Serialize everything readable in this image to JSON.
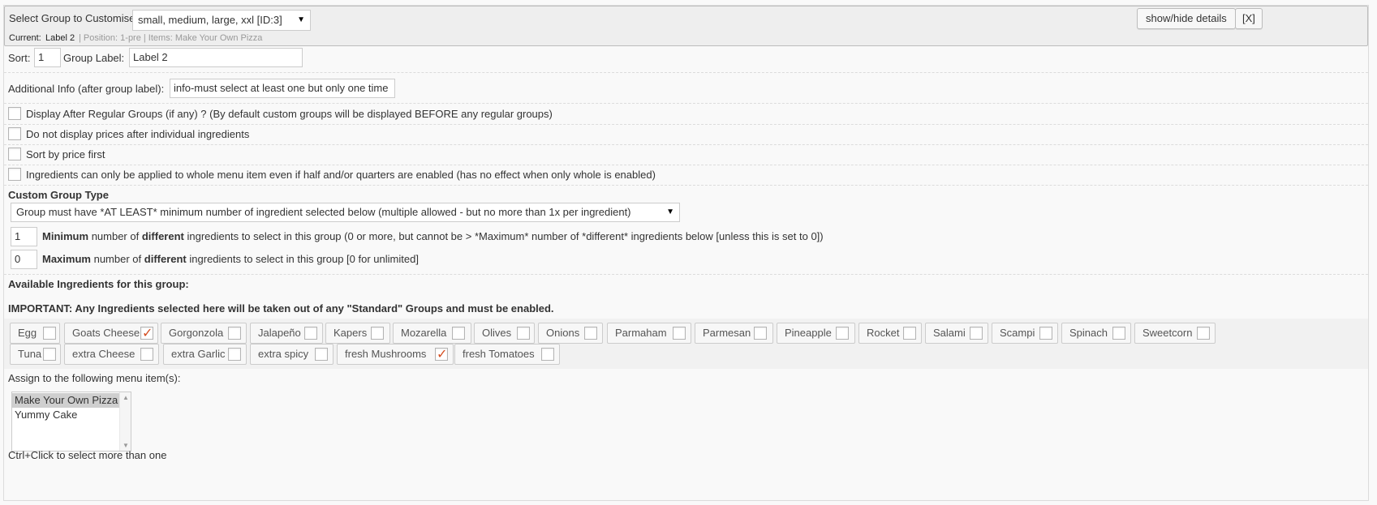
{
  "header": {
    "select_label": "Select Group to Customise",
    "group_select_value": "small, medium, large, xxl [ID:3]",
    "current_label": "Current:",
    "current_value": "Label 2",
    "position_text": "| Position: 1-pre | Items: Make Your Own Pizza",
    "toggle_details_label": "show/hide details",
    "close_label": "[X]"
  },
  "settings": {
    "sort_label": "Sort:",
    "sort_value": "1",
    "group_label_label": "Group Label:",
    "group_label_value": "Label 2",
    "additional_info_label": "Additional Info (after group label):",
    "additional_info_value": "info-must select at least one but only one time",
    "checkboxes": [
      {
        "label": "Display After Regular Groups (if any) ? (By default custom groups will be displayed BEFORE any regular groups)",
        "checked": false
      },
      {
        "label": "Do not display prices after individual ingredients",
        "checked": false
      },
      {
        "label": "Sort by price first",
        "checked": false
      },
      {
        "label": "Ingredients can only be applied to whole menu item even if half and/or quarters are enabled (has no effect when only whole is enabled)",
        "checked": false
      }
    ],
    "custom_group_type_label": "Custom Group Type",
    "custom_group_type_value": "Group must have *AT LEAST* minimum number of ingredient selected below (multiple allowed - but no more than 1x per ingredient)",
    "minimum": {
      "value": "1",
      "b1": "Minimum",
      "t1": "number of",
      "b2": "different",
      "t2": "ingredients to select in this group (0 or more, but cannot be > *Maximum* number of *different* ingredients below [unless this is set to 0])"
    },
    "maximum": {
      "value": "0",
      "b1": "Maximum",
      "t1": "number of",
      "b2": "different",
      "t2": "ingredients to select in this group [0 for unlimited]"
    }
  },
  "ingredients": {
    "available_label": "Available Ingredients for this group:",
    "important_note": "IMPORTANT: Any Ingredients selected here will be taken out of any \"Standard\" Groups and must be enabled.",
    "items": [
      {
        "name": "Egg",
        "checked": false
      },
      {
        "name": "Goats Cheese",
        "checked": true
      },
      {
        "name": "Gorgonzola",
        "checked": false
      },
      {
        "name": "Jalapeño",
        "checked": false
      },
      {
        "name": "Kapers",
        "checked": false
      },
      {
        "name": "Mozarella",
        "checked": false
      },
      {
        "name": "Olives",
        "checked": false
      },
      {
        "name": "Onions",
        "checked": false
      },
      {
        "name": "Parmaham",
        "checked": false
      },
      {
        "name": "Parmesan",
        "checked": false
      },
      {
        "name": "Pineapple",
        "checked": false
      },
      {
        "name": "Rocket",
        "checked": false
      },
      {
        "name": "Salami",
        "checked": false
      },
      {
        "name": "Scampi",
        "checked": false
      },
      {
        "name": "Spinach",
        "checked": false
      },
      {
        "name": "Sweetcorn",
        "checked": false
      },
      {
        "name": "Tuna",
        "checked": false
      },
      {
        "name": "extra Cheese",
        "checked": false
      },
      {
        "name": "extra Garlic",
        "checked": false
      },
      {
        "name": "extra spicy",
        "checked": false
      },
      {
        "name": "fresh Mushrooms",
        "checked": true
      },
      {
        "name": "fresh Tomatoes",
        "checked": false
      }
    ]
  },
  "assign": {
    "label": "Assign to the following menu item(s):",
    "options": [
      {
        "label": "Make Your Own Pizza",
        "selected": true
      },
      {
        "label": "Yummy Cake",
        "selected": false
      }
    ],
    "hint": "Ctrl+Click to select more than one"
  },
  "colors": {
    "check_mark": "#d54e21",
    "selected_option": "#cfcfcf"
  }
}
